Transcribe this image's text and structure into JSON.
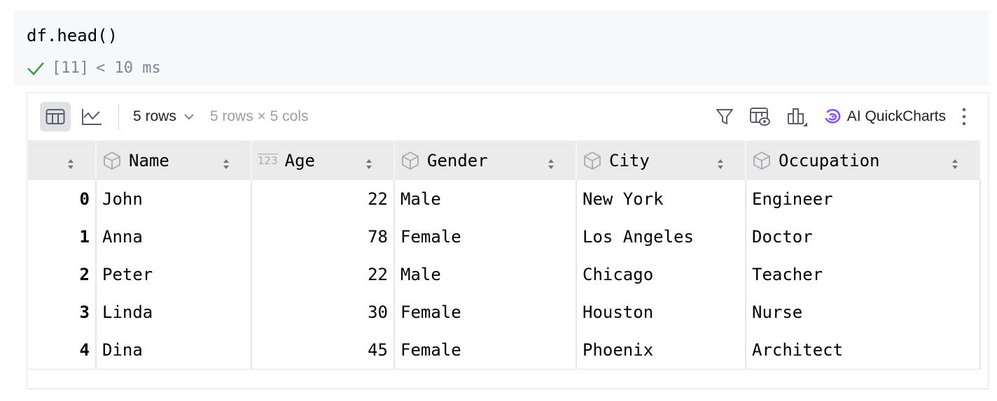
{
  "cell": {
    "code": "df.head()",
    "exec_count": "[11]",
    "duration": "< 10 ms"
  },
  "toolbar": {
    "rows_select": "5 rows",
    "shape": "5 rows × 5 cols",
    "ai_label": "AI QuickCharts",
    "accent": "#8a4fff"
  },
  "table": {
    "columns": [
      {
        "name": "Name",
        "type": "object"
      },
      {
        "name": "Age",
        "type": "int"
      },
      {
        "name": "Gender",
        "type": "object"
      },
      {
        "name": "City",
        "type": "object"
      },
      {
        "name": "Occupation",
        "type": "object"
      }
    ],
    "rows": [
      {
        "idx": "0",
        "Name": "John",
        "Age": "22",
        "Gender": "Male",
        "City": "New York",
        "Occupation": "Engineer"
      },
      {
        "idx": "1",
        "Name": "Anna",
        "Age": "78",
        "Gender": "Female",
        "City": "Los Angeles",
        "Occupation": "Doctor"
      },
      {
        "idx": "2",
        "Name": "Peter",
        "Age": "22",
        "Gender": "Male",
        "City": "Chicago",
        "Occupation": "Teacher"
      },
      {
        "idx": "3",
        "Name": "Linda",
        "Age": "30",
        "Gender": "Female",
        "City": "Houston",
        "Occupation": "Nurse"
      },
      {
        "idx": "4",
        "Name": "Dina",
        "Age": "45",
        "Gender": "Female",
        "City": "Phoenix",
        "Occupation": "Architect"
      }
    ]
  }
}
